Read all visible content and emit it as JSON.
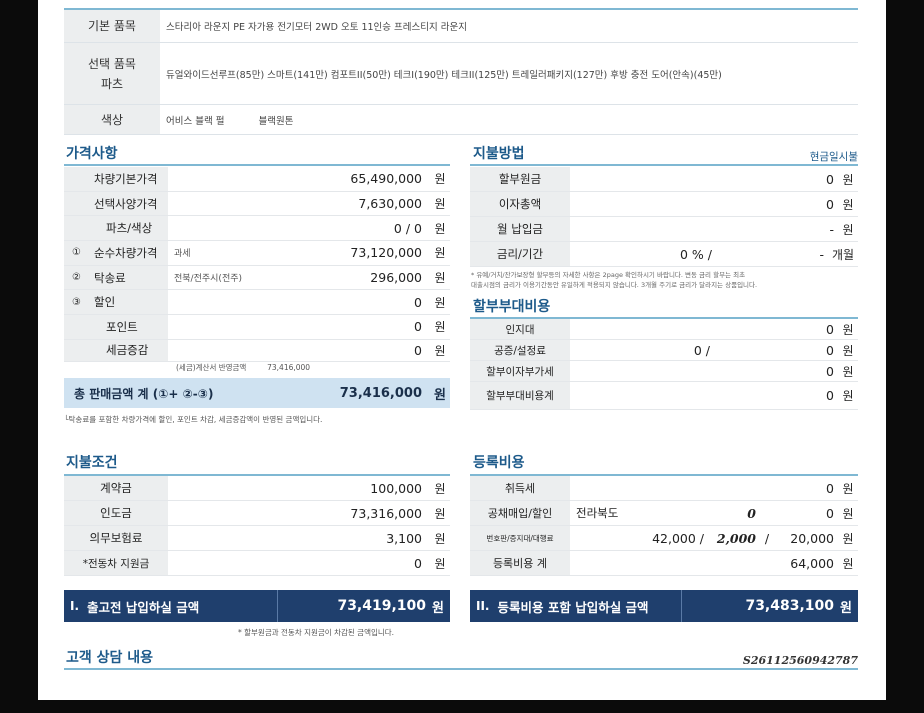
{
  "spec": {
    "model_label": "기본 품목",
    "model_value": "스타리아 라운지 PE 자가용 전기모터 2WD 오토 11인승 프레스티지 라운지",
    "options_label_1": "선택 품목",
    "options_label_2": "파츠",
    "options_value": "듀얼와이드선루프(85만) 스마트(141만) 컴포트II(50만) 테크I(190만) 테크II(125만) 트레일러패키지(127만) 후방 충전 도어(안속)(45만)",
    "color_label": "색상",
    "color_exterior": "어비스 블랙 펄",
    "color_interior": "블랙원톤"
  },
  "price": {
    "title": "가격사항",
    "rows": [
      {
        "num": "",
        "label": "차량기본가격",
        "mid": "",
        "value": "65,490,000",
        "unit": "원"
      },
      {
        "num": "",
        "label": "선택사양가격",
        "mid": "",
        "value": "7,630,000",
        "unit": "원"
      },
      {
        "num": "",
        "label": "파츠/색상",
        "mid": "",
        "value": "0 / 0",
        "unit": "원"
      },
      {
        "num": "①",
        "label": "순수차량가격",
        "mid": "과세",
        "value": "73,120,000",
        "unit": "원"
      },
      {
        "num": "②",
        "label": "탁송료",
        "mid": "전북/전주시(전주)",
        "value": "296,000",
        "unit": "원"
      },
      {
        "num": "③",
        "label": "할인",
        "mid": "",
        "value": "0",
        "unit": "원"
      },
      {
        "num": "",
        "label": "포인트",
        "mid": "",
        "value": "0",
        "unit": "원"
      },
      {
        "num": "",
        "label": "세금증감",
        "mid": "",
        "value": "0",
        "unit": "원"
      }
    ],
    "tax_note_label": "(세금)계산서 반영금액",
    "tax_note_value": "73,416,000",
    "total_label": "총 판매금액 계 (①+ ②-③)",
    "total_value": "73,416,000",
    "total_unit": "원",
    "footnote": "└탁송료를 포함한 차량가격에 할인, 포인트 차감, 세금증감액이 반영된 금액입니다."
  },
  "payment_method": {
    "title": "지불방법",
    "mode": "현금일시불",
    "rows": [
      {
        "label": "할부원금",
        "value": "0",
        "unit": "원"
      },
      {
        "label": "이자총액",
        "value": "0",
        "unit": "원"
      },
      {
        "label": "월 납입금",
        "value": "-",
        "unit": "원"
      },
      {
        "label": "금리/기간",
        "rate": "0 % /",
        "value": "-",
        "unit": "개월"
      }
    ],
    "note_1": "* 유예/거치/잔가보장형 할부등의 자세한 사항은 2page 확인하시기 바랍니다. 변동 금리 할부는 최초",
    "note_2": "대출시점의 금리가 이용기간동안 유일하게 적용되지 않습니다. 3개월 주기로 금리가 달라지는 상품입니다."
  },
  "installment_costs": {
    "title": "할부부대비용",
    "rows": [
      {
        "label": "인지대",
        "mid": "",
        "value": "0",
        "unit": "원"
      },
      {
        "label": "공증/설정료",
        "mid": "0 /",
        "value": "0",
        "unit": "원"
      },
      {
        "label": "할부이자부가세",
        "mid": "",
        "value": "0",
        "unit": "원"
      },
      {
        "label": "할부부대비용계",
        "mid": "",
        "value": "0",
        "unit": "원"
      }
    ]
  },
  "payment_terms": {
    "title": "지불조건",
    "rows": [
      {
        "label": "계약금",
        "value": "100,000",
        "unit": "원"
      },
      {
        "label": "인도금",
        "value": "73,316,000",
        "unit": "원"
      },
      {
        "label": "의무보험료",
        "value": "3,100",
        "unit": "원"
      },
      {
        "label": "*전동차 지원금",
        "value": "0",
        "unit": "원"
      }
    ],
    "bar_symbol": "I.",
    "bar_label": "출고전 납입하실 금액",
    "bar_value": "73,419,100",
    "bar_unit": "원",
    "footnote": "* 할부원금과 전동차 지원금이 차감된 금액입니다."
  },
  "registration": {
    "title": "등록비용",
    "rows": [
      {
        "label": "취득세",
        "region": "",
        "a": "",
        "b": "",
        "value": "0",
        "unit": "원"
      },
      {
        "label": "공채매입/할인",
        "region": "전라북도",
        "a": "",
        "b": "0",
        "value": "0",
        "unit": "원"
      },
      {
        "label": "번호판/증지대/대행료",
        "region": "",
        "a": "42,000 /",
        "b": "2,000",
        "c": "/",
        "value": "20,000",
        "unit": "원"
      },
      {
        "label": "등록비용 계",
        "region": "",
        "a": "",
        "b": "",
        "value": "64,000",
        "unit": "원"
      }
    ],
    "bar_symbol": "II.",
    "bar_label": "등록비용 포함 납입하실 금액",
    "bar_value": "73,483,100",
    "bar_unit": "원"
  },
  "consult": {
    "title": "고객 상담 내용",
    "doc_id": "S26112560942787"
  }
}
